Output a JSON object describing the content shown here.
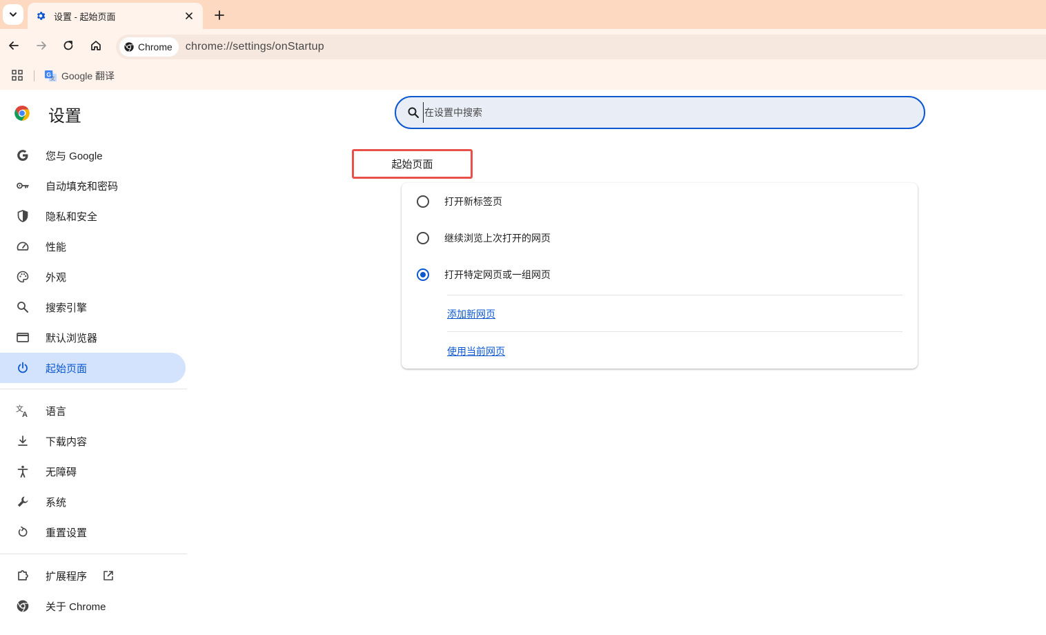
{
  "browser": {
    "tab": {
      "title": "设置 - 起始页面"
    },
    "omnibox": {
      "chip_label": "Chrome",
      "url": "chrome://settings/onStartup"
    },
    "bookmarks": [
      {
        "label": "Google 翻译"
      }
    ]
  },
  "settings": {
    "title": "设置",
    "search": {
      "placeholder": "在设置中搜索"
    },
    "nav": {
      "group1": [
        {
          "label": "您与 Google",
          "icon": "google-g-icon"
        },
        {
          "label": "自动填充和密码",
          "icon": "key-icon"
        },
        {
          "label": "隐私和安全",
          "icon": "shield-icon"
        },
        {
          "label": "性能",
          "icon": "speedometer-icon"
        },
        {
          "label": "外观",
          "icon": "palette-icon"
        },
        {
          "label": "搜索引擎",
          "icon": "search-icon"
        },
        {
          "label": "默认浏览器",
          "icon": "browser-window-icon"
        },
        {
          "label": "起始页面",
          "icon": "power-icon",
          "active": true
        }
      ],
      "group2": [
        {
          "label": "语言",
          "icon": "translate-icon"
        },
        {
          "label": "下载内容",
          "icon": "download-icon"
        },
        {
          "label": "无障碍",
          "icon": "accessibility-icon"
        },
        {
          "label": "系统",
          "icon": "wrench-icon"
        },
        {
          "label": "重置设置",
          "icon": "reset-icon"
        }
      ],
      "group3": [
        {
          "label": "扩展程序",
          "icon": "puzzle-icon"
        },
        {
          "label": "关于 Chrome",
          "icon": "chrome-logo-icon"
        }
      ]
    },
    "section_title": "起始页面",
    "options": [
      {
        "label": "打开新标签页",
        "checked": false
      },
      {
        "label": "继续浏览上次打开的网页",
        "checked": false
      },
      {
        "label": "打开特定网页或一组网页",
        "checked": true
      }
    ],
    "links": {
      "add_page": "添加新网页",
      "use_current": "使用当前网页"
    }
  },
  "colors": {
    "accent": "#0b57d0",
    "active_nav_bg": "#d3e3fd",
    "tabstrip": "#fcd9c0",
    "toolbar": "#fff3ec",
    "highlight_box": "#e8514a"
  }
}
